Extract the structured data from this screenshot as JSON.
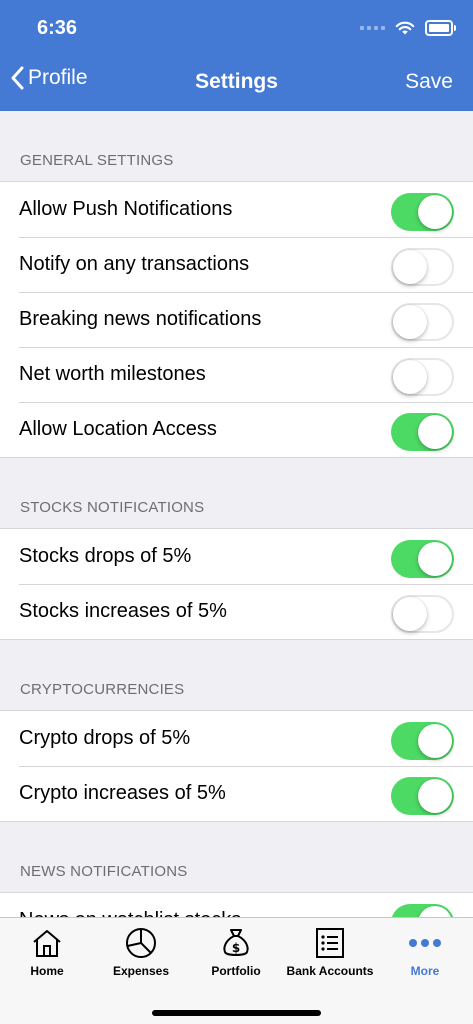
{
  "status_bar": {
    "time": "6:36"
  },
  "nav": {
    "back_label": "Profile",
    "title": "Settings",
    "save_label": "Save"
  },
  "sections": [
    {
      "header": "GENERAL SETTINGS",
      "rows": [
        {
          "label": "Allow Push Notifications",
          "on": true
        },
        {
          "label": "Notify on any transactions",
          "on": false
        },
        {
          "label": "Breaking news notifications",
          "on": false
        },
        {
          "label": "Net worth milestones",
          "on": false
        },
        {
          "label": "Allow Location Access",
          "on": true
        }
      ]
    },
    {
      "header": "STOCKS NOTIFICATIONS",
      "rows": [
        {
          "label": "Stocks drops of 5%",
          "on": true
        },
        {
          "label": "Stocks increases of 5%",
          "on": false
        }
      ]
    },
    {
      "header": "CRYPTOCURRENCIES",
      "rows": [
        {
          "label": "Crypto drops of 5%",
          "on": true
        },
        {
          "label": "Crypto increases of 5%",
          "on": true
        }
      ]
    },
    {
      "header": "NEWS NOTIFICATIONS",
      "rows": [
        {
          "label": "News on watchlist stocks",
          "on": true
        }
      ]
    }
  ],
  "tabbar": {
    "tabs": [
      {
        "label": "Home",
        "icon": "home-icon",
        "active": false
      },
      {
        "label": "Expenses",
        "icon": "pie-chart-icon",
        "active": false
      },
      {
        "label": "Portfolio",
        "icon": "money-bag-icon",
        "active": false
      },
      {
        "label": "Bank Accounts",
        "icon": "list-icon",
        "active": false
      },
      {
        "label": "More",
        "icon": "more-icon",
        "active": true
      }
    ]
  },
  "colors": {
    "header": "#4479d4",
    "toggle_on": "#4cd964",
    "active_tab": "#4479d4"
  }
}
